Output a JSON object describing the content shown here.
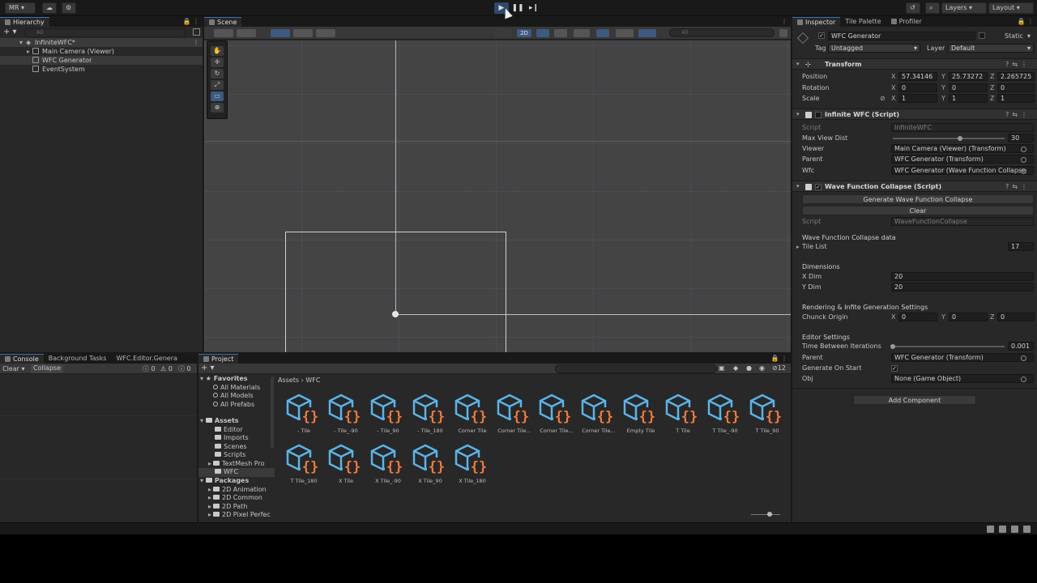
{
  "toolbar": {
    "account": "MR",
    "layers": "Layers",
    "layout": "Layout"
  },
  "hierarchy": {
    "tab": "Hierarchy",
    "search_placeholder": "All",
    "items": [
      {
        "label": "InfiniteWFC*"
      },
      {
        "label": "Main Camera (Viewer)"
      },
      {
        "label": "WFC Generator"
      },
      {
        "label": "EventSystem"
      }
    ]
  },
  "scene": {
    "tab": "Scene",
    "mode_2d": "2D",
    "search_placeholder": "All"
  },
  "inspector": {
    "tabs": [
      "Inspector",
      "Tile Palette",
      "Profiler"
    ],
    "object_name": "WFC Generator",
    "static_label": "Static",
    "tag_label": "Tag",
    "tag_value": "Untagged",
    "layer_label": "Layer",
    "layer_value": "Default",
    "transform": {
      "title": "Transform",
      "position_label": "Position",
      "rotation_label": "Rotation",
      "scale_label": "Scale",
      "position": {
        "x": "57.34146",
        "y": "25.73272",
        "z": "2.265725"
      },
      "rotation": {
        "x": "0",
        "y": "0",
        "z": "0"
      },
      "scale": {
        "x": "1",
        "y": "1",
        "z": "1"
      }
    },
    "infinite_wfc": {
      "title": "Infinite WFC (Script)",
      "script_label": "Script",
      "script_value": "InfiniteWFC",
      "max_view_dist_label": "Max View Dist",
      "max_view_dist_value": "30",
      "max_view_dist_fraction": 0.6,
      "viewer_label": "Viewer",
      "viewer_value": "Main Camera (Viewer) (Transform)",
      "parent_label": "Parent",
      "parent_value": "WFC Generator (Transform)",
      "wfc_label": "Wfc",
      "wfc_value": "WFC Generator (Wave Function Collapse"
    },
    "wfc_script": {
      "title": "Wave Function Collapse (Script)",
      "generate_button": "Generate Wave Function Collapse",
      "clear_button": "Clear",
      "script_label": "Script",
      "script_value": "WaveFunctionCollapse",
      "data_header": "Wave Function Collapse data",
      "tile_list_label": "Tile List",
      "tile_list_count": "17",
      "dimensions_header": "Dimensions",
      "xdim_label": "X Dim",
      "xdim_value": "20",
      "ydim_label": "Y Dim",
      "ydim_value": "20",
      "rendering_header": "Rendering & Infite Generation Settings",
      "chunk_origin_label": "Chunck Origin",
      "chunk_origin": {
        "x": "0",
        "y": "0",
        "z": "0"
      },
      "editor_header": "Editor Settings",
      "time_between_label": "Time Between Iterations",
      "time_between_value": "0.001",
      "time_between_fraction": 0.0,
      "parent_label": "Parent",
      "parent_value": "WFC Generator (Transform)",
      "generate_on_start_label": "Generate On Start",
      "obj_label": "Obj",
      "obj_value": "None (Game Object)"
    },
    "add_component": "Add Component"
  },
  "console": {
    "tabs": [
      "Console",
      "Background Tasks",
      "WFC.Editor.Genera"
    ],
    "clear": "Clear",
    "collapse": "Collapse",
    "counts": [
      "0",
      "0",
      "0"
    ]
  },
  "project": {
    "tab": "Project",
    "badge_count": "12",
    "favorites_header": "Favorites",
    "favorites": [
      "All Materials",
      "All Models",
      "All Prefabs"
    ],
    "assets_header": "Assets",
    "asset_folders": [
      "Editor",
      "Imports",
      "Scenes",
      "Scripts",
      "TextMesh Pro",
      "WFC"
    ],
    "packages_header": "Packages",
    "packages": [
      "2D Animation",
      "2D Common",
      "2D Path",
      "2D Pixel Perfec"
    ],
    "breadcrumb_root": "Assets",
    "breadcrumb_leaf": "WFC",
    "assets": [
      "- Tile",
      "- Tile_-90",
      "- Tile_90",
      "- Tile_180",
      "Corner Tile",
      "Corner Tile...",
      "Corner Tile...",
      "Corner Tile...",
      "Empty Tile",
      "T Tile",
      "T Tile_-90",
      "T Tile_90",
      "T Tile_180",
      "X Tile",
      "X Tile_-90",
      "X Tile_90",
      "X Tile_180"
    ]
  },
  "colors": {
    "cube_blue": "#5ab4e8",
    "brace_orange": "#f07a3a",
    "accent_blue": "#3a72b0"
  }
}
